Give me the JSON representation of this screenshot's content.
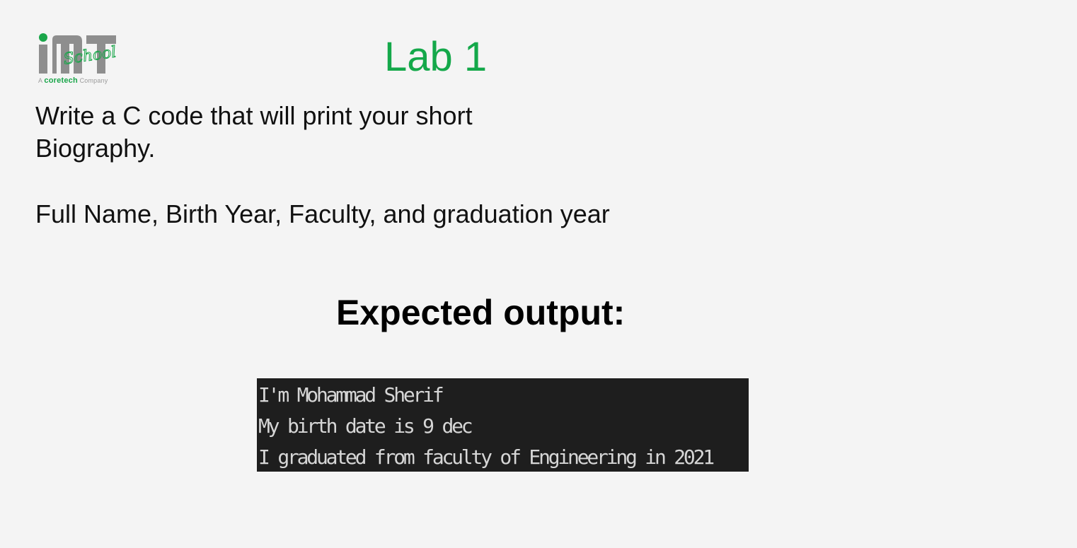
{
  "logo": {
    "wordmark_script": "School",
    "tagline_prefix": "A",
    "tagline_brand": "coretech",
    "tagline_suffix": "Company",
    "accent_color": "#1aa64a",
    "mark_color": "#8e8e8e"
  },
  "title": "Lab 1",
  "task": {
    "line1": "Write a C code that will print your short Biography.",
    "line2": "Full Name, Birth Year, Faculty, and graduation year"
  },
  "expected_heading": "Expected output:",
  "console_output": [
    "I'm Mohammad Sherif",
    "My birth date is 9 dec",
    "I graduated from faculty of Engineering in 2021"
  ],
  "colors": {
    "background": "#f4f4f4",
    "title": "#14a84a",
    "console_bg": "#1e1e1e",
    "console_text": "#d6d6d6"
  }
}
